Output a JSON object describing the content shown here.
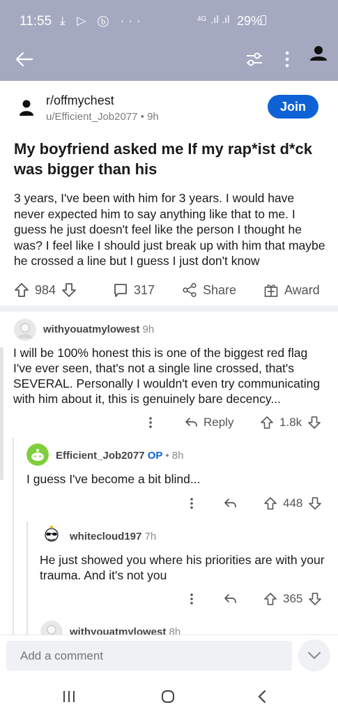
{
  "status_bar": {
    "time": "11:55",
    "network": "4G",
    "battery": "29%"
  },
  "app_bar": {
    "icons": [
      "back-arrow-icon",
      "filter-icon",
      "more-vertical-icon",
      "user-icon"
    ]
  },
  "post": {
    "subreddit": "r/offmychest",
    "author": "u/Efficient_Job2077",
    "age": "9h",
    "join_label": "Join",
    "title": "My boyfriend asked me If my rap*ist d*ck was bigger than his",
    "body": "3 years, I've been with him for 3 years. I would have never expected him to say anything like that to me. I guess he just doesn't feel like the person I thought he was? I feel like I should just break up with him that maybe he crossed a line but I guess I just don't know",
    "votes": "984",
    "comments": "317",
    "share_label": "Share",
    "award_label": "Award"
  },
  "comments": [
    {
      "author": "withyouatmylowest",
      "age": "9h",
      "body": "I will be 100% honest this is one of the biggest red flag I've ever seen, that's not a single line crossed, that's SEVERAL. Personally I wouldn't even try communicating with him about it, this is genuinely bare decency...",
      "reply_label": "Reply",
      "votes": "1.8k"
    },
    {
      "author": "Efficient_Job2077",
      "op_badge": "OP",
      "age": "8h",
      "body": "I guess I've become a bit blind...",
      "votes": "448"
    },
    {
      "author": "whitecloud197",
      "age": "7h",
      "body": "He just showed you where his priorities are with your trauma. And it's not you",
      "votes": "365"
    },
    {
      "author": "withyouatmylowest",
      "age": "8h"
    }
  ],
  "composer": {
    "placeholder": "Add a comment"
  },
  "colors": {
    "header_bg": "#a4a9c0",
    "join_blue": "#0f62d6",
    "text": "#1a1a1b"
  }
}
